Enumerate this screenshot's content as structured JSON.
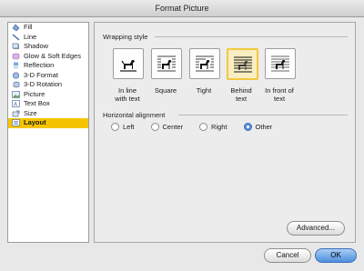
{
  "window": {
    "title": "Format Picture"
  },
  "sidebar": {
    "items": [
      {
        "label": "Fill",
        "icon": "fill-icon"
      },
      {
        "label": "Line",
        "icon": "line-icon"
      },
      {
        "label": "Shadow",
        "icon": "shadow-icon"
      },
      {
        "label": "Glow & Soft Edges",
        "icon": "glow-icon"
      },
      {
        "label": "Reflection",
        "icon": "reflection-icon"
      },
      {
        "label": "3-D Format",
        "icon": "3d-format-icon"
      },
      {
        "label": "3-D Rotation",
        "icon": "3d-rotation-icon"
      },
      {
        "label": "Picture",
        "icon": "picture-icon"
      },
      {
        "label": "Text Box",
        "icon": "text-box-icon"
      },
      {
        "label": "Size",
        "icon": "size-icon"
      },
      {
        "label": "Layout",
        "icon": "layout-icon",
        "selected": true
      }
    ]
  },
  "wrapping": {
    "title": "Wrapping style",
    "options": [
      {
        "label1": "In line",
        "label2": "with text"
      },
      {
        "label1": "Square",
        "label2": ""
      },
      {
        "label1": "Tight",
        "label2": ""
      },
      {
        "label1": "Behind",
        "label2": "text",
        "selected": true
      },
      {
        "label1": "In front of",
        "label2": "text"
      }
    ]
  },
  "alignment": {
    "title": "Horizontal alignment",
    "options": [
      {
        "label": "Left"
      },
      {
        "label": "Center"
      },
      {
        "label": "Right"
      },
      {
        "label": "Other",
        "selected": true
      }
    ]
  },
  "buttons": {
    "advanced": "Advanced...",
    "cancel": "Cancel",
    "ok": "OK"
  },
  "colors": {
    "selection": "#f5c400",
    "accent": "#4d8fdc"
  }
}
